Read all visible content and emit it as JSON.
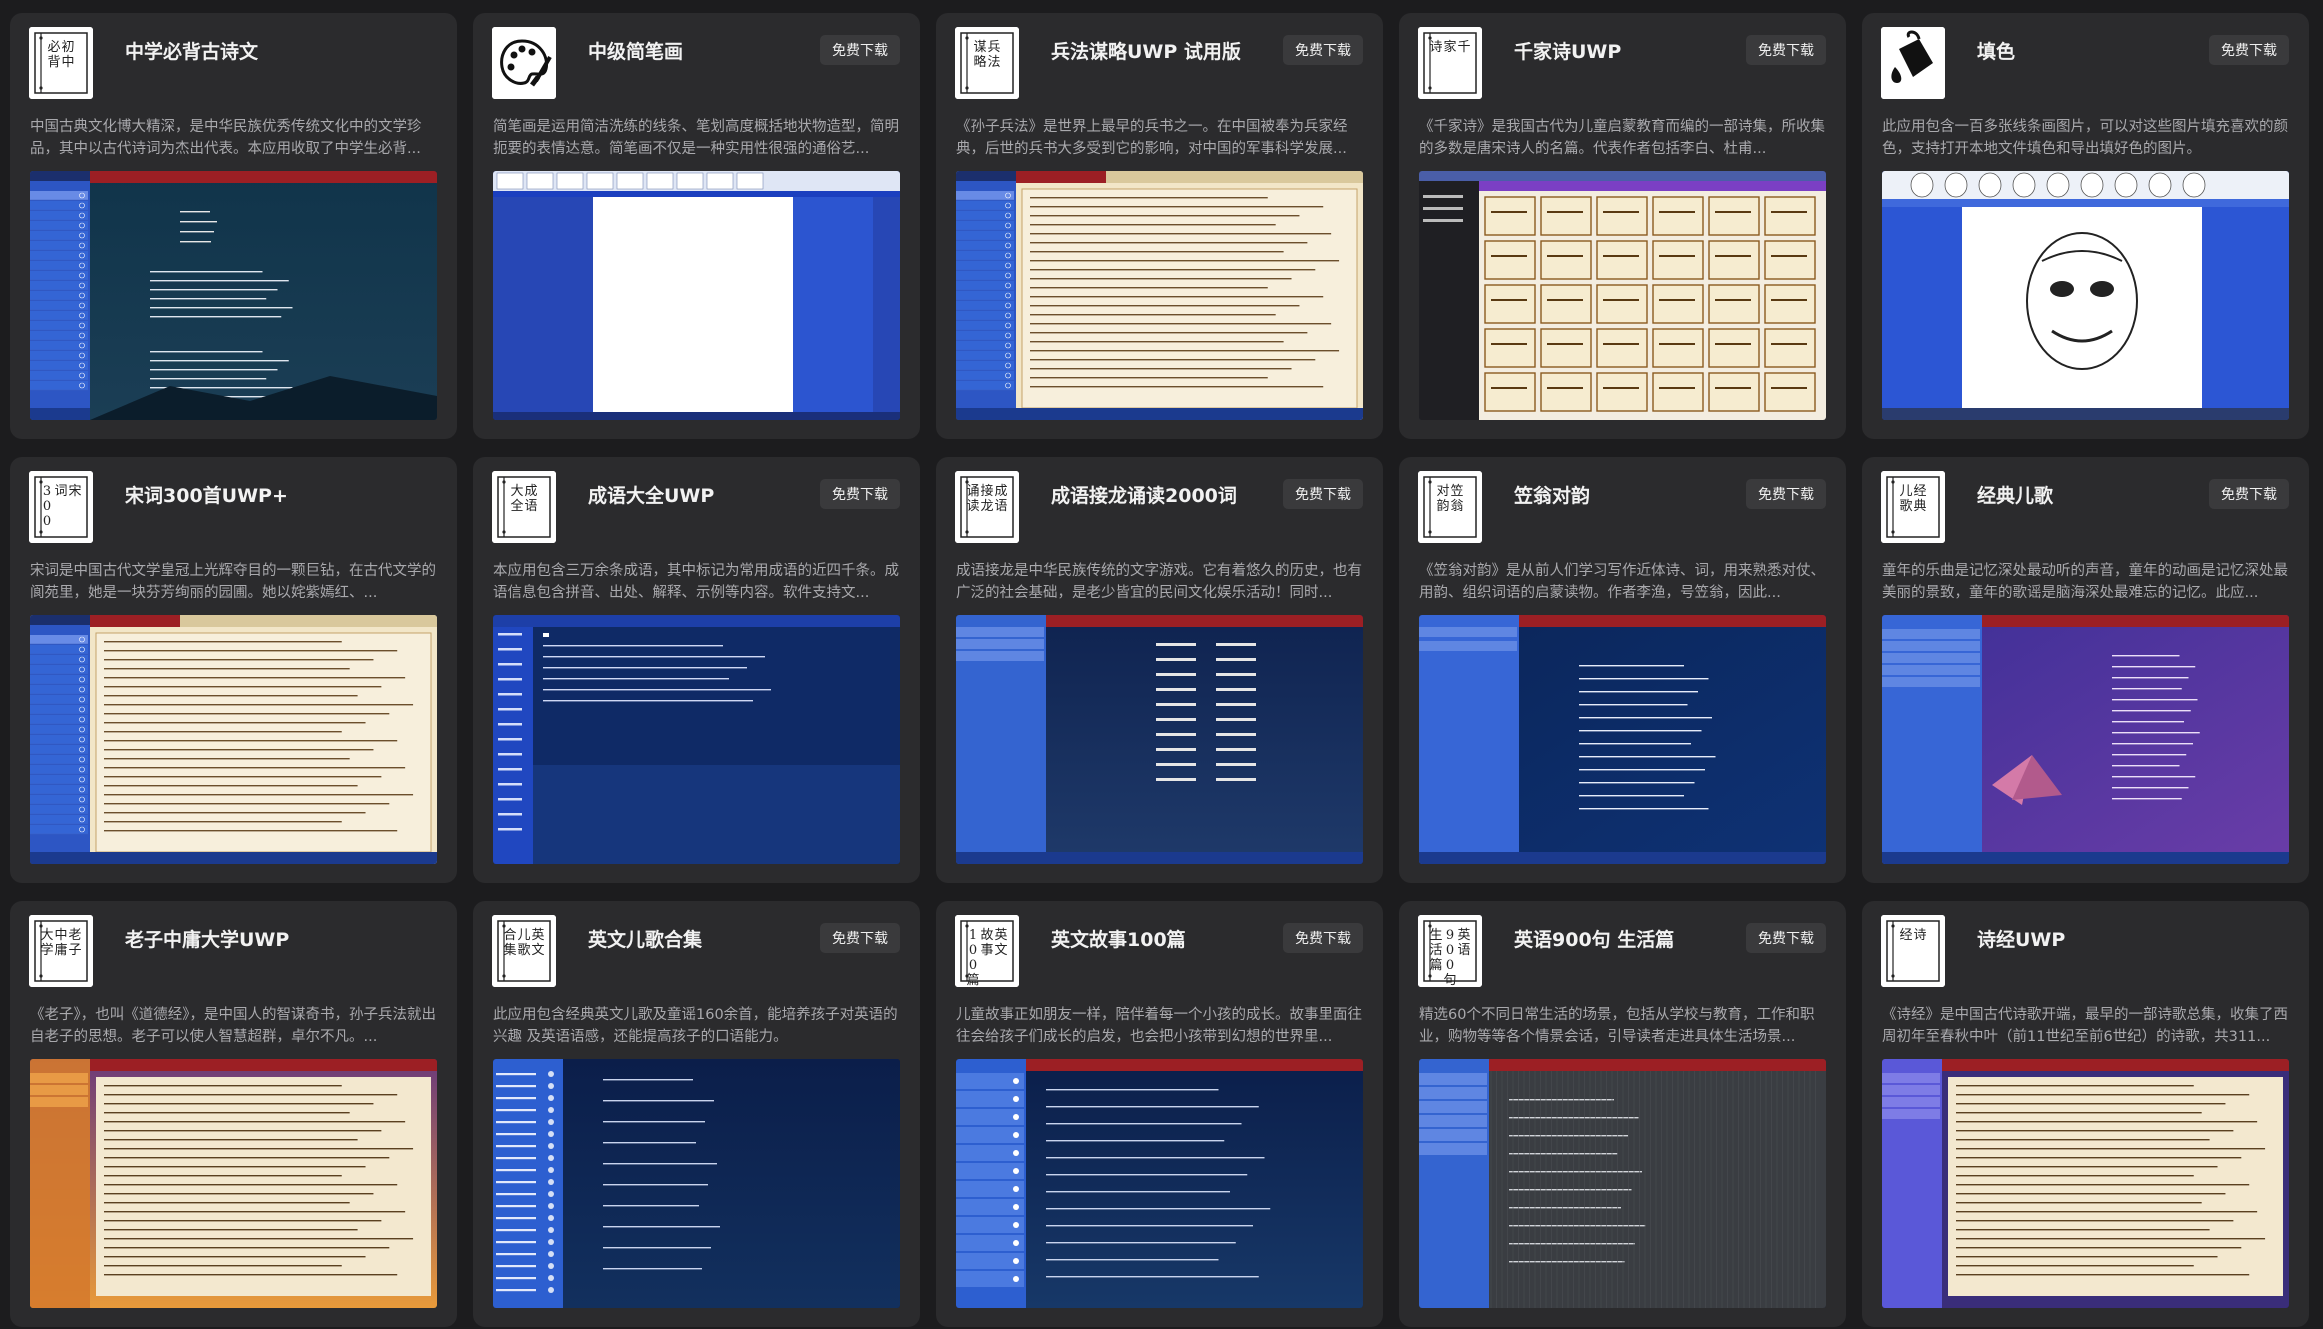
{
  "cards": [
    {
      "title": "中学必背古诗文",
      "badge": "",
      "icon": "scroll-book-icon",
      "desc": "中国古典文化博大精深，是中华民族优秀传统文化中的文学珍品，其中以古代诗词为杰出代表。本应用收取了中学生必背...",
      "shot": "poem-night-app"
    },
    {
      "title": "中级简笔画",
      "badge": "免费下载",
      "icon": "palette-icon",
      "desc": "简笔画是运用简洁洗练的线条、笔划高度概括地状物造型，简明扼要的表情达意。简笔画不仅是一种实用性很强的通俗艺...",
      "shot": "drawing-app"
    },
    {
      "title": "兵法谋略UWP 试用版",
      "badge": "免费下载",
      "icon": "scroll-book-icon",
      "desc": "《孙子兵法》是世界上最早的兵书之一。在中国被奉为兵家经典，后世的兵书大多受到它的影响，对中国的军事科学发展...",
      "shot": "scroll-text-app"
    },
    {
      "title": "千家诗UWP",
      "badge": "免费下载",
      "icon": "scroll-book-icon",
      "desc": "《千家诗》是我国古代为儿童启蒙教育而编的一部诗集，所收集的多数是唐宋诗人的名篇。代表作者包括李白、杜甫...",
      "shot": "poem-grid-app"
    },
    {
      "title": "填色",
      "badge": "免费下载",
      "icon": "paint-bucket-icon",
      "desc": "此应用包含一百多张线条画图片，可以对这些图片填充喜欢的颜色，支持打开本地文件填色和导出填好色的图片。",
      "shot": "coloring-app"
    },
    {
      "title": "宋词300首UWP+",
      "badge": "",
      "icon": "scroll-book-icon",
      "desc": "宋词是中国古代文学皇冠上光辉夺目的一颗巨钻，在古代文学的阆苑里，她是一块芬芳绚丽的园圃。她以姹紫嫣红、...",
      "shot": "scroll-text-app"
    },
    {
      "title": "成语大全UWP",
      "badge": "免费下载",
      "icon": "scroll-book-icon",
      "desc": "本应用包含三万余条成语，其中标记为常用成语的近四千条。成语信息包含拼音、出处、解释、示例等内容。软件支持文...",
      "shot": "idiom-list-app"
    },
    {
      "title": "成语接龙诵读2000词",
      "badge": "免费下载",
      "icon": "scroll-book-icon",
      "desc": "成语接龙是中华民族传统的文字游戏。它有着悠久的历史，也有广泛的社会基础，是老少皆宜的民间文化娱乐活动！同时...",
      "shot": "idiom-chain-app"
    },
    {
      "title": "笠翁对韵",
      "badge": "免费下载",
      "icon": "scroll-book-icon",
      "desc": "《笠翁对韵》是从前人们学习写作近体诗、词，用来熟悉对仗、用韵、组织词语的启蒙读物。作者李渔，号笠翁，因此...",
      "shot": "poem-dark-app"
    },
    {
      "title": "经典儿歌",
      "badge": "免费下载",
      "icon": "scroll-book-icon",
      "desc": "童年的乐曲是记忆深处最动听的声音，童年的动画是记忆深处最美丽的景致，童年的歌谣是脑海深处最难忘的记忆。此应...",
      "shot": "kids-song-app"
    },
    {
      "title": "老子中庸大学UWP",
      "badge": "",
      "icon": "scroll-book-icon",
      "desc": "《老子》，也叫《道德经》，是中国人的智谋奇书，孙子兵法就出自老子的思想。老子可以使人智慧超群，卓尔不凡。...",
      "shot": "scroll-sunset-app"
    },
    {
      "title": "英文儿歌合集",
      "badge": "免费下载",
      "icon": "scroll-book-icon",
      "desc": "此应用包含经典英文儿歌及童谣160余首，能培养孩子对英语的兴趣 及英语语感，还能提高孩子的口语能力。",
      "shot": "english-song-app"
    },
    {
      "title": "英文故事100篇",
      "badge": "免费下载",
      "icon": "scroll-book-icon",
      "desc": "儿童故事正如朋友一样，陪伴着每一个小孩的成长。故事里面往往会给孩子们成长的启发，也会把小孩带到幻想的世界里...",
      "shot": "english-story-app"
    },
    {
      "title": "英语900句 生活篇",
      "badge": "免费下载",
      "icon": "scroll-book-icon",
      "desc": "精选60个不同日常生活的场景，包括从学校与教育，工作和职业，购物等等各个情景会话，引导读者走进具体生活场景...",
      "shot": "english-900-app"
    },
    {
      "title": "诗经UWP",
      "badge": "",
      "icon": "scroll-book-icon",
      "desc": "《诗经》是中国古代诗歌开端，最早的一部诗歌总集，收集了西周初年至春秋中叶（前11世纪至前6世纪）的诗歌，共311...",
      "shot": "scroll-purple-app"
    }
  ],
  "icon_text": [
    "初中|必背",
    "",
    "兵法|谋略",
    "千|家|诗",
    "",
    "宋|词|300",
    "成语|大全",
    "成语|接龙|诵读",
    "笠翁|对韵",
    "经典|儿歌",
    "老子|中庸|大学",
    "英文|儿歌|合集",
    "英文|故事|100篇",
    "英语|900句|生活篇",
    "诗|经"
  ],
  "colors": {
    "page_bg": "#1c1c1e",
    "card_bg": "#2b2b2d",
    "badge_bg": "#3a3a3c",
    "app_blue": "#2a4fb8",
    "app_red": "#9c1f24",
    "parchment": "#efe4c9"
  }
}
